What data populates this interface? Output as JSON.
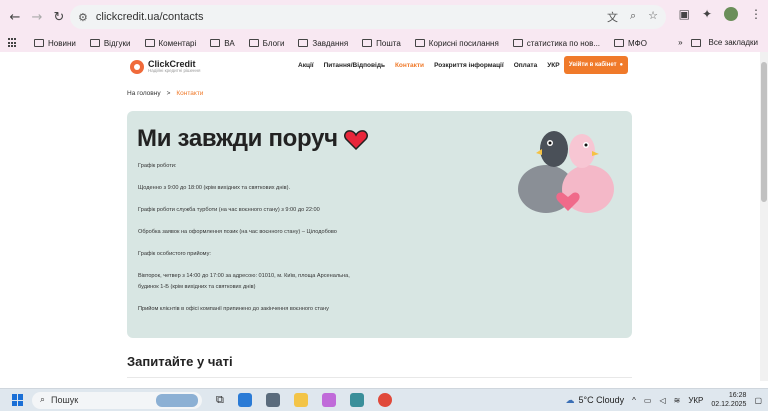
{
  "browser": {
    "url": "clickcredit.ua/contacts",
    "back_icon": "←",
    "forward_icon": "→",
    "reload_icon": "↻"
  },
  "bookmarks": {
    "items": [
      "Новини",
      "Відгуки",
      "Коментарі",
      "ВА",
      "Блоги",
      "Завдання",
      "Пошта",
      "Корисні посилання",
      "статистика по нов...",
      "МФО"
    ],
    "all_label": "Все закладки",
    "more_icon": "»"
  },
  "site": {
    "logo_name": "ClickCredit",
    "logo_tag": "Надійні кредитні рішення",
    "menu": [
      "Акції",
      "Питання/Відповідь",
      "Контакти",
      "Розкриття інформації",
      "Оплата",
      "УКР"
    ],
    "active_menu": "Контакти",
    "cabinet_button": "Увійти в кабінет"
  },
  "breadcrumb": {
    "home": "На головну",
    "separator": ">",
    "current": "Контакти"
  },
  "card": {
    "title": "Ми завжди поруч",
    "lines": [
      "Графік роботи:",
      "",
      "Щоденно з 9:00 до 18:00 (крім вихідних та святкових днів).",
      "",
      "Графік роботи служба турботи (на час воєнного стану) з 9:00 до 22:00",
      "",
      "Обробка заявок на оформлення позик (на час воєнного стану) – Цілодобово",
      "",
      "Графік особистого прийому:",
      "",
      "Вівторок, четвер з 14:00 до 17:00 за адресою: 01010, м. Київ, площа Арсенальна,",
      "будинок 1-Б (крім вихідних та святкових днів)",
      "",
      "Прийом клієнтів в офісі компанії припинено до закінчення воєнного стану"
    ]
  },
  "chat": {
    "title": "Запитайте у чаті"
  },
  "taskbar": {
    "search_label": "Пошук",
    "weather": "5°C  Cloudy",
    "lang": "УКР",
    "time": "16:28",
    "date": "02.12.2025"
  },
  "colors": {
    "accent": "#f07a2a",
    "card_bg": "#d8e6e3",
    "browser_bg": "#f8e8f2"
  }
}
